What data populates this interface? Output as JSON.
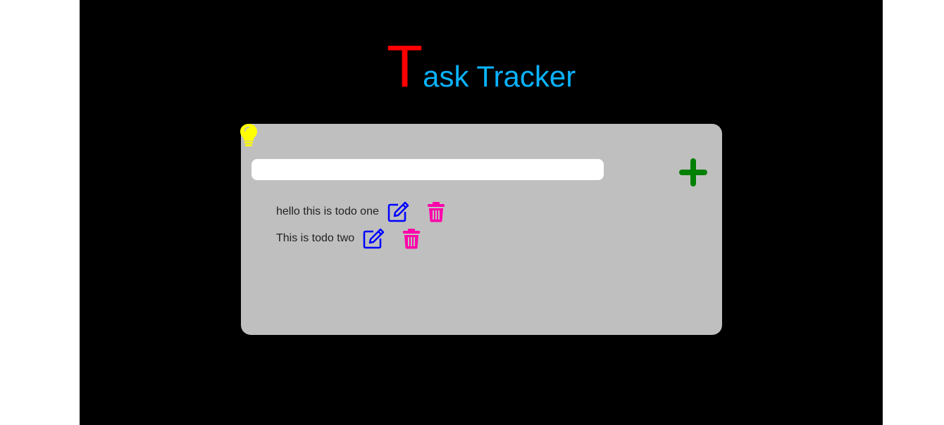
{
  "header": {
    "title_first_letter": "T",
    "title_rest": "ask Tracker"
  },
  "input": {
    "value": "",
    "placeholder": ""
  },
  "todos": [
    {
      "text": "hello this is todo one"
    },
    {
      "text": "This is todo two"
    }
  ],
  "icons": {
    "bulb": "lightbulb-icon",
    "add": "plus-icon",
    "edit": "edit-icon",
    "delete": "trash-icon"
  },
  "colors": {
    "title_first_letter": "#ff0000",
    "title_rest": "#0ab3ff",
    "card_bg": "#bfbfbf",
    "bulb": "#ffff00",
    "add": "#008000",
    "edit": "#0000ff",
    "delete": "#ff00aa"
  }
}
